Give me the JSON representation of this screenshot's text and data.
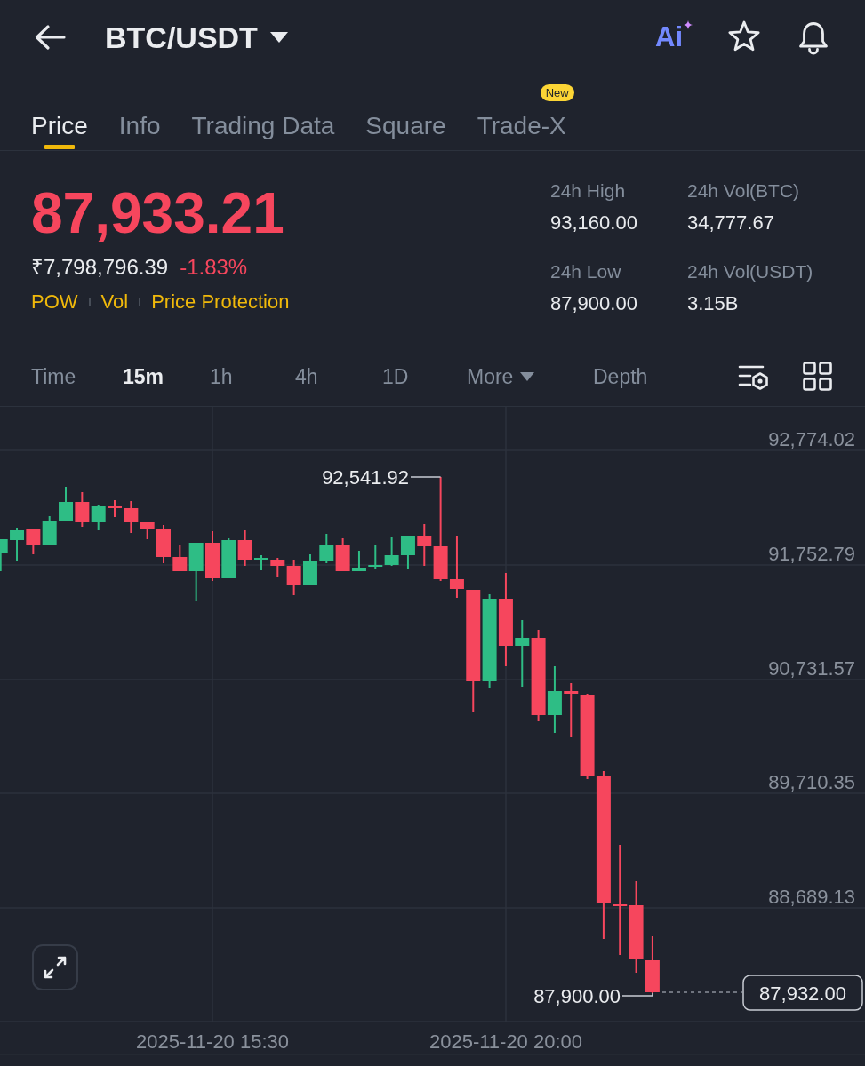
{
  "header": {
    "title": "BTC/USDT",
    "ai_label": "Ai"
  },
  "tabs": [
    {
      "label": "Price",
      "selected": true
    },
    {
      "label": "Info",
      "selected": false
    },
    {
      "label": "Trading Data",
      "selected": false
    },
    {
      "label": "Square",
      "selected": false
    },
    {
      "label": "Trade-X",
      "selected": false,
      "badge": "New"
    }
  ],
  "ticker": {
    "last_price": "87,933.21",
    "fiat_price": "₹7,798,796.39",
    "change": "-1.83%",
    "falling": true,
    "tags": [
      "POW",
      "Vol",
      "Price Protection"
    ]
  },
  "stats": [
    {
      "label": "24h High",
      "value": "93,160.00"
    },
    {
      "label": "24h Vol(BTC)",
      "value": "34,777.67"
    },
    {
      "label": "24h Low",
      "value": "87,900.00"
    },
    {
      "label": "24h Vol(USDT)",
      "value": "3.15B"
    }
  ],
  "intervals": [
    {
      "label": "Time",
      "kind": "option",
      "selected": false
    },
    {
      "label": "15m",
      "kind": "option",
      "selected": true
    },
    {
      "label": "1h",
      "kind": "option",
      "selected": false
    },
    {
      "label": "4h",
      "kind": "option",
      "selected": false
    },
    {
      "label": "1D",
      "kind": "option",
      "selected": false
    },
    {
      "label": "More",
      "kind": "menu",
      "selected": false
    },
    {
      "label": "Depth",
      "kind": "option",
      "selected": false
    }
  ],
  "chart": {
    "y_axis_labels": [
      "92,774.02",
      "91,752.79",
      "90,731.57",
      "89,710.35",
      "88,689.13"
    ],
    "x_axis_labels": [
      "2025-11-20 15:30",
      "2025-11-20 20:00"
    ],
    "high_marker": "92,541.92",
    "low_marker": "87,900.00",
    "last_price": "87,932.00"
  }
}
